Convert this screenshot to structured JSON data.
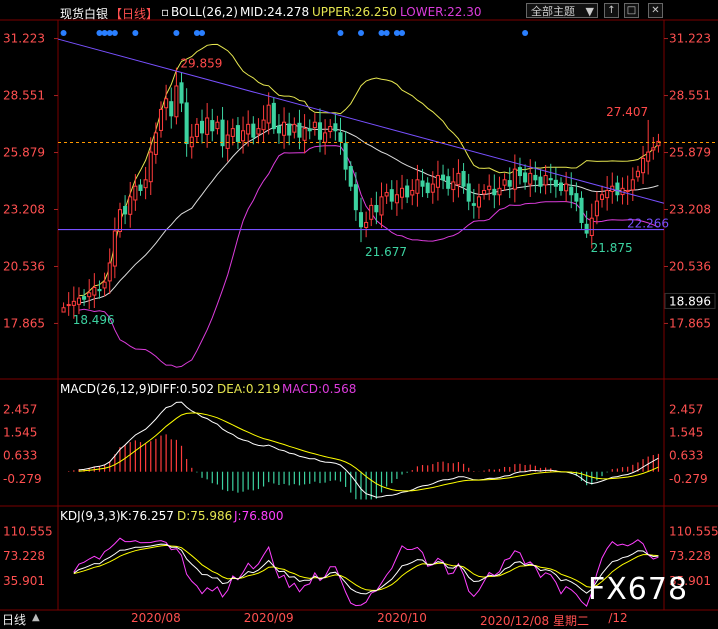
{
  "header": {
    "symbol": "现货白银",
    "period": "【日线】",
    "boll_label": "BOLL(26,2)",
    "mid_label": "MID:24.278",
    "upper_label": "UPPER:26.250",
    "lower_label": "LOWER:22.30",
    "theme_button": "全部主题",
    "theme_arrow": "▼"
  },
  "window_buttons": [
    "↑",
    "□",
    "✕"
  ],
  "main_axis": {
    "ticks": [
      31.223,
      28.551,
      25.879,
      23.208,
      20.536,
      17.865
    ],
    "tick_labels": [
      "31.223",
      "28.551",
      "25.879",
      "23.208",
      "20.536",
      "17.865"
    ],
    "ylim": [
      15.4,
      32.0
    ],
    "last_price_label": "18.896"
  },
  "annotations": {
    "high1": "29.859",
    "low1": "18.496",
    "low2": "21.677",
    "high2": "27.407",
    "low3": "21.875",
    "level": "22.266"
  },
  "macd_panel": {
    "label": "MACD(26,12,9)",
    "diff": "DIFF:0.502",
    "dea": "DEA:0.219",
    "macd": "MACD:0.568",
    "tick_labels": [
      "2.457",
      "1.545",
      "0.633",
      "-0.279"
    ],
    "ticks": [
      2.457,
      1.545,
      0.633,
      -0.279
    ],
    "ylim": [
      -1.2,
      3.0
    ]
  },
  "kdj_panel": {
    "label": "KDJ(9,3,3)",
    "k": "K:76.257",
    "d": "D:75.986",
    "j": "J:76.800",
    "tick_labels": [
      "110.555",
      "73.228",
      "35.901"
    ],
    "ticks": [
      110.555,
      73.228,
      35.901
    ],
    "ylim": [
      -5,
      125
    ]
  },
  "x_axis": {
    "labels": [
      "2020/08",
      "2020/09",
      "2020/10",
      "2020/12/08",
      "星期二",
      "/12"
    ],
    "label_positions_index": [
      18,
      40,
      66
    ]
  },
  "bottom": {
    "tab": "日线",
    "date_status": "2020/12/08 星期二",
    "watermark": "FX678"
  },
  "colors": {
    "up": "#ff3c3c",
    "down": "#3cd2a0",
    "mid": "#dcdcdc",
    "upper": "#e6e650",
    "lower": "#dc3cdc",
    "trend": "#7850ff",
    "price_line": "#ff9900",
    "k_line": "#ffffff",
    "d_line": "#ffff00",
    "j_line": "#ff40ff"
  },
  "chart_data": {
    "type": "candlestick",
    "count": 117,
    "series_close": [
      18.6,
      18.75,
      18.9,
      19.05,
      19.0,
      19.3,
      19.55,
      19.4,
      19.8,
      20.7,
      22.2,
      23.2,
      23.0,
      23.8,
      24.3,
      24.1,
      24.6,
      25.9,
      26.8,
      27.9,
      28.4,
      27.6,
      29.0,
      28.2,
      26.3,
      26.6,
      27.2,
      26.8,
      27.5,
      26.9,
      27.3,
      26.2,
      26.7,
      27.0,
      26.4,
      26.9,
      27.2,
      26.6,
      27.0,
      27.4,
      28.1,
      27.0,
      26.8,
      27.3,
      26.7,
      27.2,
      26.6,
      27.0,
      26.9,
      27.3,
      26.5,
      26.8,
      27.1,
      26.9,
      26.4,
      25.1,
      24.3,
      23.2,
      22.4,
      22.6,
      23.4,
      23.1,
      23.8,
      24.0,
      23.6,
      23.9,
      24.2,
      23.8,
      24.1,
      24.6,
      24.3,
      24.0,
      24.4,
      24.8,
      24.6,
      24.2,
      24.5,
      24.9,
      24.3,
      23.6,
      23.4,
      23.8,
      24.1,
      24.3,
      23.9,
      24.2,
      24.6,
      24.3,
      25.1,
      24.8,
      24.5,
      24.9,
      24.6,
      24.3,
      24.8,
      24.6,
      24.3,
      24.1,
      24.4,
      23.9,
      23.6,
      22.6,
      22.1,
      22.8,
      23.6,
      23.9,
      24.1,
      24.3,
      23.9,
      24.2,
      24.1,
      24.6,
      25.0,
      25.6,
      25.9,
      26.1,
      26.4
    ],
    "diff_end": 0.502,
    "dea_end": 0.219,
    "macd_end": 0.568,
    "k_end": 76.257,
    "d_end": 75.986,
    "j_end": 76.8
  }
}
